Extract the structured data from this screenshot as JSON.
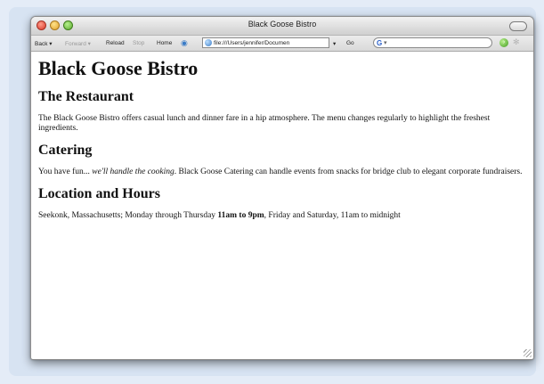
{
  "window": {
    "title": "Black Goose Bistro"
  },
  "toolbar": {
    "back": "Back",
    "forward": "Forward",
    "reload": "Reload",
    "stop": "Stop",
    "home": "Home",
    "url": "file:///Users/jennifer/Documen",
    "go": "Go"
  },
  "page": {
    "h1": "Black Goose Bistro",
    "sections": [
      {
        "heading": "The Restaurant",
        "parts": [
          "The Black Goose Bistro offers casual lunch and dinner fare in a hip atmosphere. The menu changes regularly to highlight the freshest ingredients."
        ]
      },
      {
        "heading": "Catering",
        "parts": [
          "You have fun... ",
          "we'll handle the cooking",
          ". Black Goose Catering can handle events from snacks for bridge club to elegant corporate fundraisers."
        ]
      },
      {
        "heading": "Location and Hours",
        "parts": [
          "Seekonk, Massachusetts; Monday through Thursday ",
          "11am to 9pm",
          ", Friday and Saturday, 11am to midnight"
        ]
      }
    ]
  }
}
